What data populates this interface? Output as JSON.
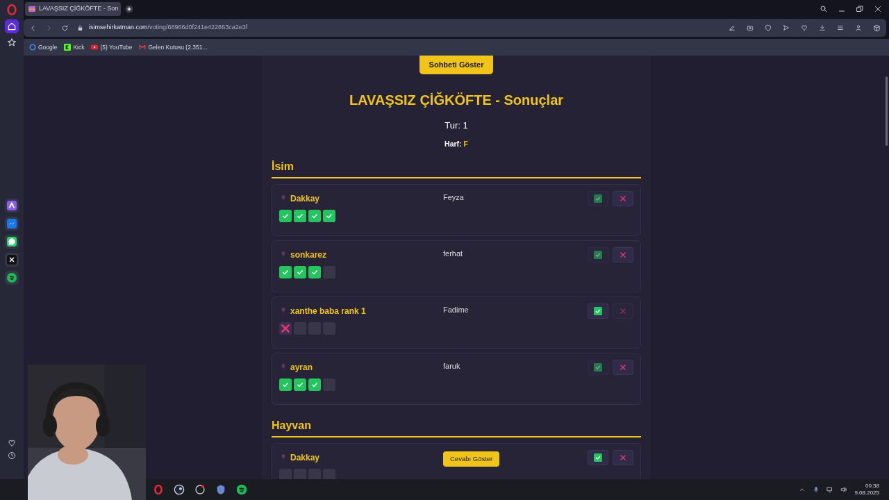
{
  "browser": {
    "tabs": [
      {
        "title": "LAVAŞSIZ ÇİĞKÖFTE - Son",
        "selected": true
      }
    ],
    "url": {
      "domain": "isimsehirkatman.com",
      "path": "/voting/68966d0f241e422863ca2e3f"
    },
    "bookmarks": [
      {
        "label": "Google"
      },
      {
        "label": "Kick"
      },
      {
        "label": "(5) YouTube"
      },
      {
        "label": "Gelen Kutusu (2.351..."
      }
    ]
  },
  "page": {
    "chat_button": "Sohbeti Göster",
    "title": "LAVAŞSIZ ÇİĞKÖFTE - Sonuçlar",
    "round": "Tur: 1",
    "letter_label": "Harf:",
    "letter": "F",
    "categories": [
      {
        "name": "İsim",
        "answers": [
          {
            "player": "Dakkay",
            "kind": "text",
            "answer": "Feyza",
            "votes": [
              {
                "kind": "yes"
              },
              {
                "kind": "yes"
              },
              {
                "kind": "yes"
              },
              {
                "kind": "yes"
              }
            ],
            "accept_active": false,
            "reject_active": true
          },
          {
            "player": "sonkarez",
            "kind": "text",
            "answer": "ferhat",
            "votes": [
              {
                "kind": "yes"
              },
              {
                "kind": "yes"
              },
              {
                "kind": "yes"
              },
              {
                "kind": "empty"
              }
            ],
            "accept_active": false,
            "reject_active": true
          },
          {
            "player": "xanthe baba rank 1",
            "kind": "text",
            "answer": "Fadime",
            "votes": [
              {
                "kind": "no"
              },
              {
                "kind": "empty"
              },
              {
                "kind": "empty"
              },
              {
                "kind": "empty"
              }
            ],
            "accept_active": true,
            "reject_active": false
          },
          {
            "player": "ayran",
            "kind": "text",
            "answer": "faruk",
            "votes": [
              {
                "kind": "yes"
              },
              {
                "kind": "yes"
              },
              {
                "kind": "yes"
              },
              {
                "kind": "empty"
              }
            ],
            "accept_active": false,
            "reject_active": true
          }
        ]
      },
      {
        "name": "Hayvan",
        "answers": [
          {
            "player": "Dakkay",
            "kind": "button",
            "answer": "Cevabı Göster",
            "votes": [
              {
                "kind": "empty"
              },
              {
                "kind": "empty"
              },
              {
                "kind": "empty"
              },
              {
                "kind": "empty"
              }
            ],
            "accept_active": true,
            "reject_active": true
          }
        ]
      }
    ]
  },
  "taskbar": {
    "time": "00:38",
    "date": "9.08.2025"
  }
}
